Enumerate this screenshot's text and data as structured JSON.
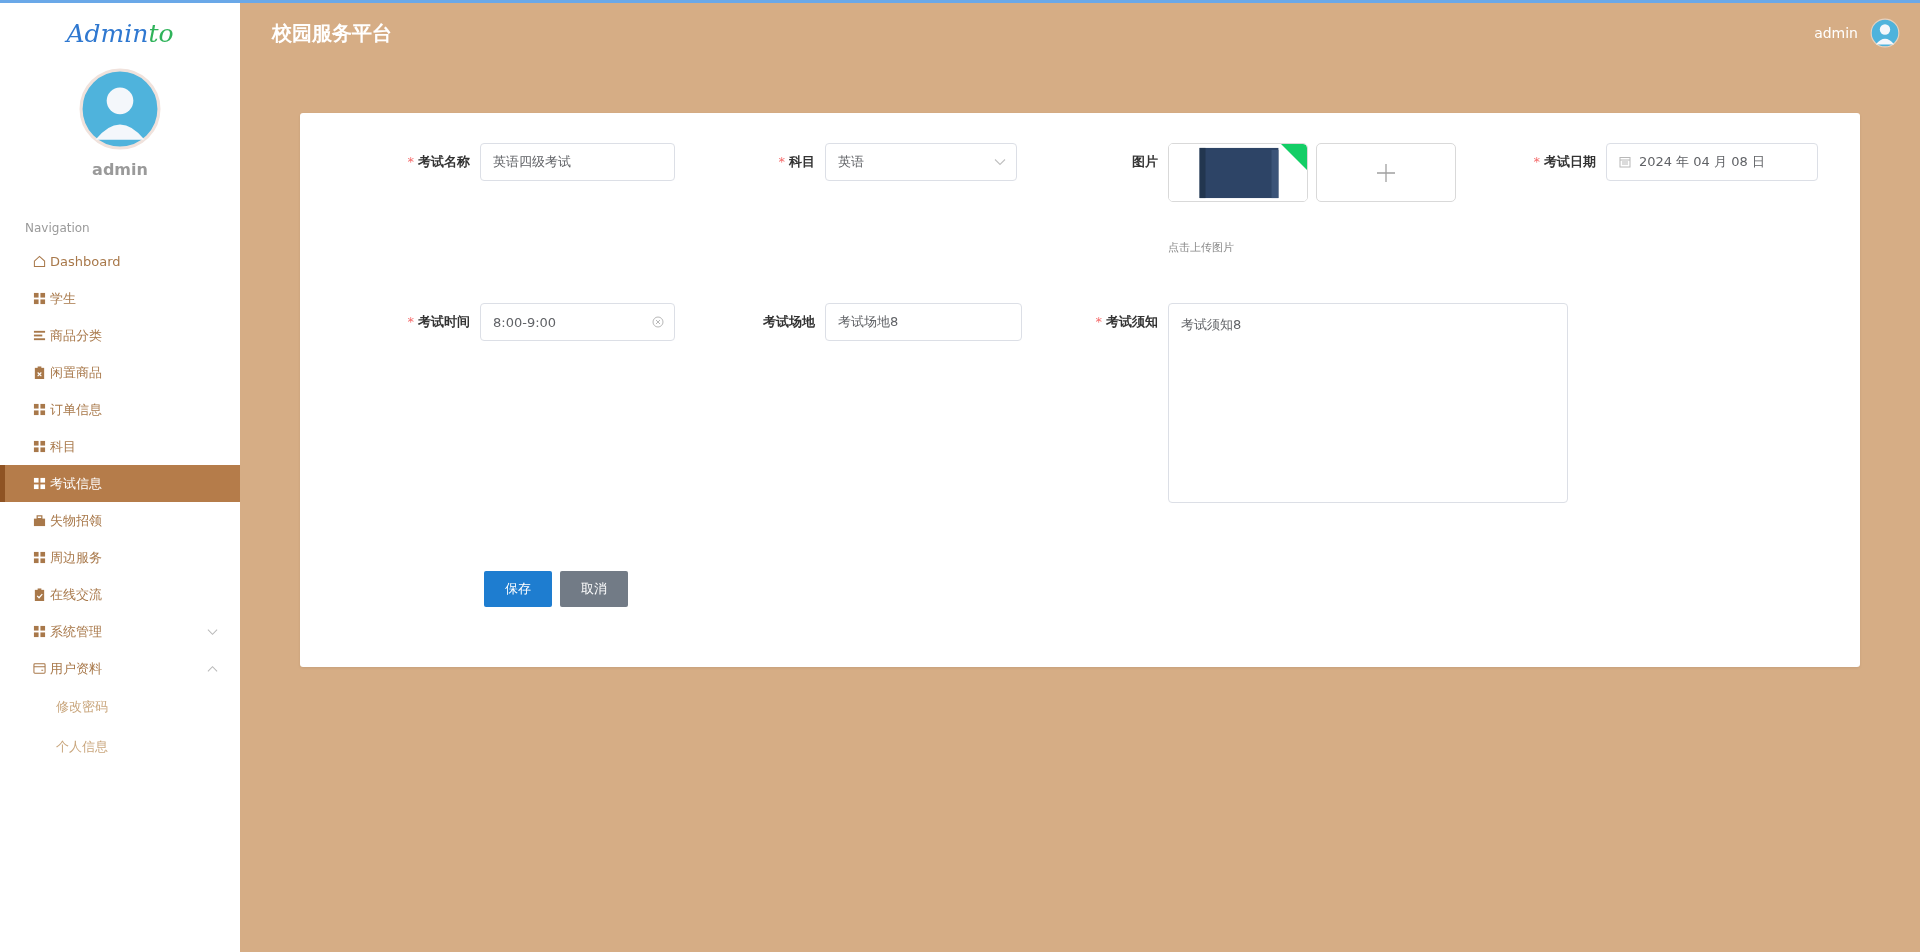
{
  "sidebar": {
    "logo_parts": [
      {
        "text": "Admin",
        "color": "#2f78d0"
      },
      {
        "text": "to",
        "color": "#2fb35a"
      }
    ],
    "user": "admin",
    "nav_heading": "Navigation",
    "items": [
      {
        "label": "Dashboard",
        "kind": "home",
        "selected": false
      },
      {
        "label": "学生",
        "kind": "grid",
        "selected": false
      },
      {
        "label": "商品分类",
        "kind": "list",
        "selected": false
      },
      {
        "label": "闲置商品",
        "kind": "clipboard-x",
        "selected": false
      },
      {
        "label": "订单信息",
        "kind": "grid",
        "selected": false
      },
      {
        "label": "科目",
        "kind": "grid",
        "selected": false
      },
      {
        "label": "考试信息",
        "kind": "grid",
        "selected": true
      },
      {
        "label": "失物招领",
        "kind": "briefcase",
        "selected": false
      },
      {
        "label": "周边服务",
        "kind": "grid",
        "selected": false
      },
      {
        "label": "在线交流",
        "kind": "clipboard-check",
        "selected": false
      },
      {
        "label": "系统管理",
        "kind": "grid",
        "selected": false,
        "expanded": false
      },
      {
        "label": "用户资料",
        "kind": "card",
        "selected": false,
        "expanded": true,
        "children": [
          {
            "label": "修改密码",
            "selected": false
          },
          {
            "label": "个人信息",
            "selected": false
          }
        ]
      }
    ]
  },
  "header": {
    "title": "校园服务平台",
    "user": "admin"
  },
  "form": {
    "rows": [
      [
        {
          "kind": "input",
          "required_mark": "*",
          "label": "考试名称",
          "value": "英语四级考试",
          "clearable": false
        },
        {
          "kind": "select",
          "required_mark": "*",
          "label": "科目",
          "value": "英语"
        },
        {
          "kind": "upload",
          "label": "图片",
          "hint": "点击上传图片",
          "uploaded": true
        },
        {
          "kind": "date",
          "required_mark": "*",
          "label": "考试日期",
          "value": "2024 年 04 月 08 日"
        }
      ],
      [
        {
          "kind": "input",
          "required_mark": "*",
          "label": "考试时间",
          "value": "8:00-9:00",
          "clearable": true
        },
        {
          "kind": "input",
          "label": "考试场地",
          "value": "考试场地8",
          "clearable": false
        },
        {
          "kind": "textarea",
          "required_mark": "*",
          "label": "考试须知",
          "value": "考试须知8"
        }
      ]
    ],
    "buttons": [
      {
        "label": "保存",
        "kind": "primary"
      },
      {
        "label": "取消",
        "kind": "secondary"
      }
    ]
  }
}
